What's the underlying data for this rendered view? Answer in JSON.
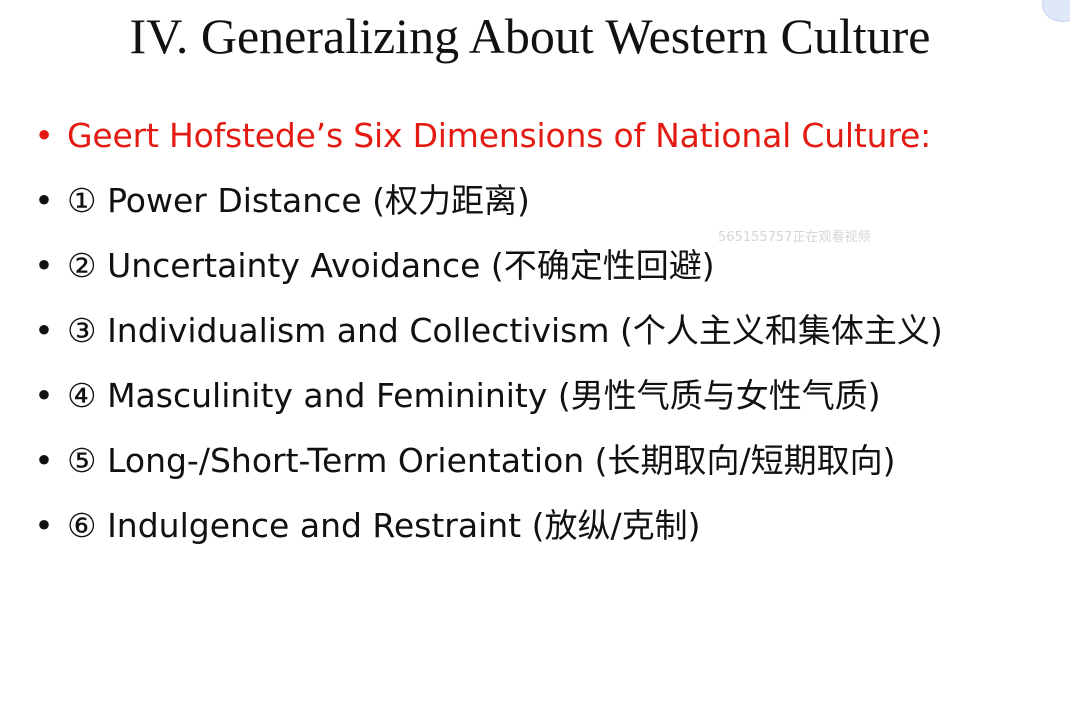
{
  "slide": {
    "title": "IV. Generalizing About Western Culture",
    "bullet_char": "•",
    "heading": "Geert Hofstede’s Six Dimensions of National Culture:",
    "items": [
      "① Power Distance (权力距离)",
      "② Uncertainty Avoidance (不确定性回避)",
      "③ Individualism and Collectivism (个人主义和集体主义)",
      "④ Masculinity and Femininity (男性气质与女性气质)",
      "⑤ Long-/Short-Term Orientation (长期取向/短期取向)",
      "⑥ Indulgence and Restraint (放纵/克制)"
    ],
    "watermark": "565155757正在观看视频"
  },
  "colors": {
    "heading": "#e31b12",
    "text": "#111111",
    "background": "#ffffff"
  }
}
